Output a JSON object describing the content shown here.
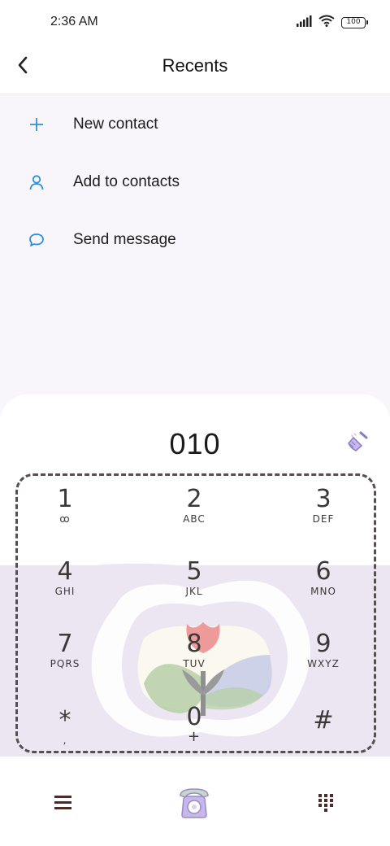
{
  "status_bar": {
    "time": "2:36 AM",
    "battery": "100",
    "icons": [
      "signal-icon",
      "wifi-icon",
      "battery-icon"
    ]
  },
  "header": {
    "title": "Recents",
    "back_icon": "chevron-left-icon"
  },
  "actions": [
    {
      "label": "New contact",
      "icon": "plus-icon"
    },
    {
      "label": "Add to contacts",
      "icon": "person-icon"
    },
    {
      "label": "Send message",
      "icon": "chat-bubble-icon"
    }
  ],
  "dialer": {
    "number": "010",
    "clear_icon": "broom-icon",
    "keys": [
      {
        "digit": "1",
        "letters": "ꝏ"
      },
      {
        "digit": "2",
        "letters": "ABC"
      },
      {
        "digit": "3",
        "letters": "DEF"
      },
      {
        "digit": "4",
        "letters": "GHI"
      },
      {
        "digit": "5",
        "letters": "JKL"
      },
      {
        "digit": "6",
        "letters": "MNO"
      },
      {
        "digit": "7",
        "letters": "PQRS"
      },
      {
        "digit": "8",
        "letters": "TUV"
      },
      {
        "digit": "9",
        "letters": "WXYZ"
      },
      {
        "digit": "*",
        "letters": ","
      },
      {
        "digit": "0",
        "letters": "+"
      },
      {
        "digit": "#",
        "letters": ""
      }
    ]
  },
  "bottom_bar": {
    "left_icon": "menu-icon",
    "center_icon": "phone-call-icon",
    "right_icon": "dialpad-icon"
  },
  "colors": {
    "accent": "#2f8fd8",
    "dialer_tint": "#ece6f3",
    "keypad_border": "#55504f"
  }
}
